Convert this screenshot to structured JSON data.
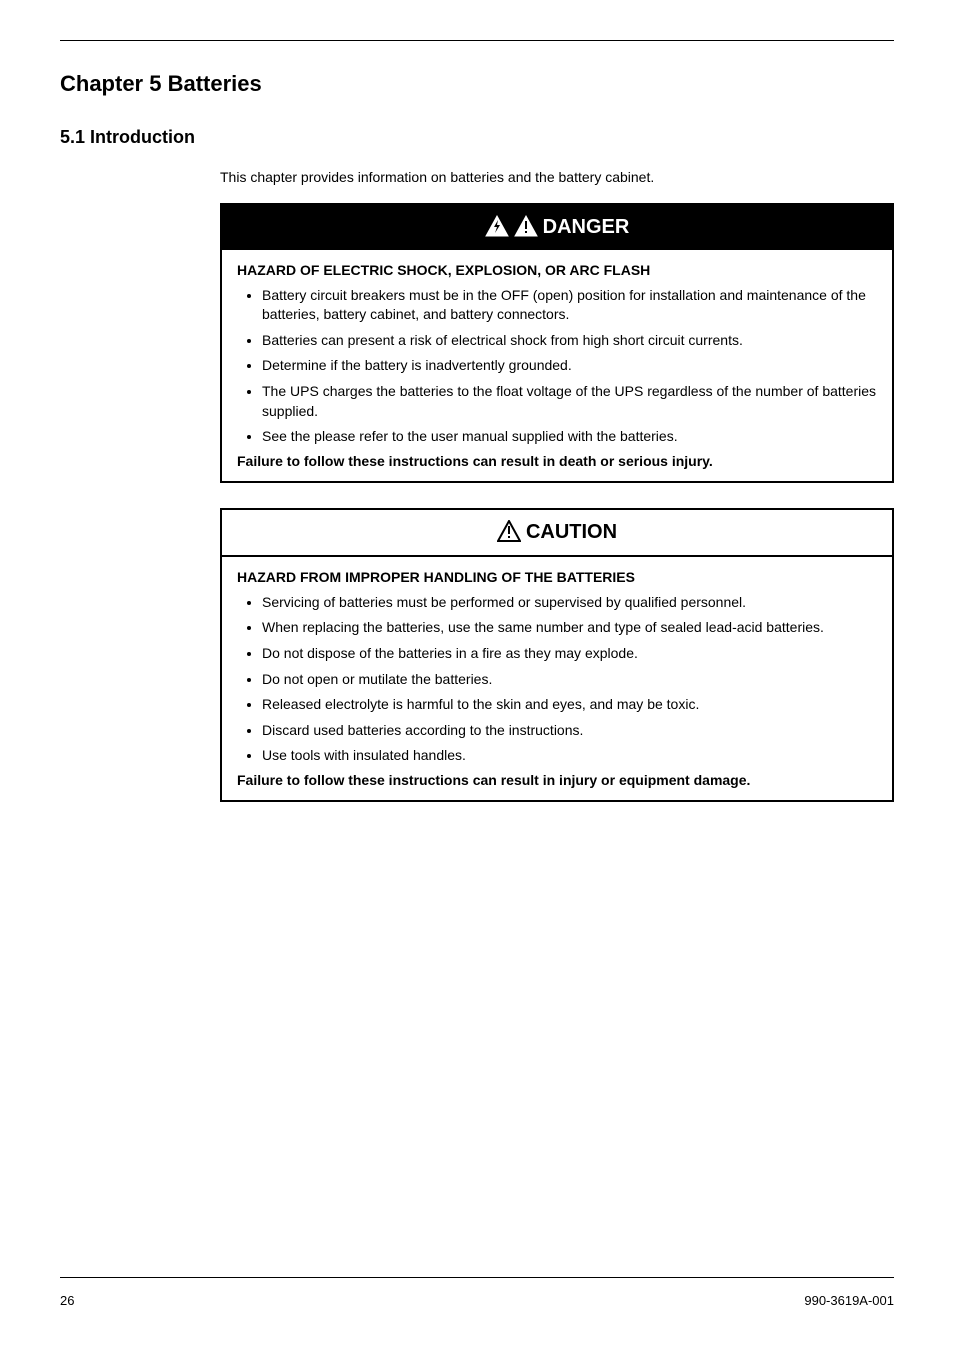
{
  "chapter": {
    "title": "Chapter 5 Batteries",
    "section": "5.1 Introduction",
    "intro": "This chapter provides information on batteries and the battery cabinet."
  },
  "danger": {
    "title": "DANGER",
    "subtitle": "HAZARD OF ELECTRIC SHOCK, EXPLOSION, OR ARC FLASH",
    "items": [
      "Battery circuit breakers must be in the OFF (open) position for installation and maintenance of the batteries, battery cabinet, and battery connectors.",
      "Batteries can present a risk of electrical shock from high short circuit currents.",
      "Determine if the battery is inadvertently grounded.",
      "The UPS charges the batteries to the float voltage of the UPS regardless of the number of batteries supplied.",
      "See the please refer to the user manual supplied with the batteries."
    ],
    "failure": "Failure to follow these instructions can result in death or serious injury."
  },
  "caution": {
    "title": "CAUTION",
    "subtitle": "HAZARD FROM IMPROPER HANDLING OF THE BATTERIES",
    "items": [
      "Servicing of batteries must be performed or supervised by qualified personnel.",
      "When replacing the batteries, use the same number and type of sealed lead-acid batteries.",
      "Do not dispose of the batteries in a fire as they may explode.",
      "Do not open or mutilate the batteries.",
      "Released electrolyte is harmful to the skin and eyes, and may be toxic.",
      "Discard used batteries according to the instructions.",
      "Use tools with insulated handles."
    ],
    "failure": "Failure to follow these instructions can result in injury or equipment damage."
  },
  "footer": {
    "left": "26",
    "right": "990-3619A-001"
  }
}
